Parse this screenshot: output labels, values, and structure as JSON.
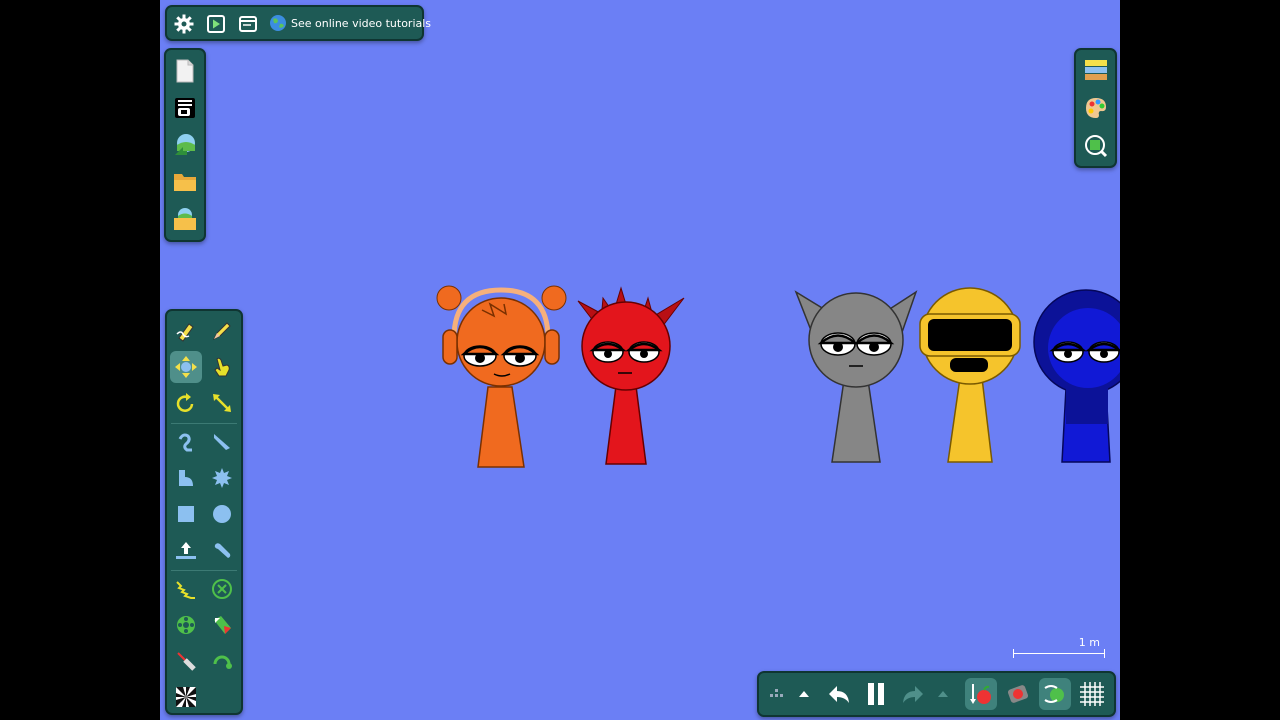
{
  "app": {
    "background_color": "#6b7ff5",
    "panel_color": "#1e5a55"
  },
  "top_bar": {
    "settings_icon": "gear-icon",
    "play_icon": "play-window-icon",
    "window_icon": "window-icon",
    "tutorial_icon": "globe-icon",
    "tutorial_label": "See online video tutorials"
  },
  "file_panel": {
    "items": [
      {
        "name": "new-file",
        "icon": "blank-page-icon"
      },
      {
        "name": "save",
        "icon": "save-icon"
      },
      {
        "name": "load-scene",
        "icon": "scene-open-icon"
      },
      {
        "name": "open-folder",
        "icon": "folder-icon"
      },
      {
        "name": "browse-scenes",
        "icon": "scene-folder-icon"
      }
    ]
  },
  "tool_panel": {
    "selected": "move",
    "tools": [
      "draw",
      "pencil",
      "move",
      "drag",
      "rotate",
      "scale",
      "rope",
      "knife",
      "polygon",
      "gear",
      "box",
      "circle",
      "plane",
      "brush",
      "spring",
      "fixate",
      "hinge",
      "thruster",
      "laser",
      "tracer",
      "chain",
      "spiral"
    ]
  },
  "right_panel": {
    "items": [
      {
        "name": "layers",
        "icon": "layers-icon"
      },
      {
        "name": "palette",
        "icon": "palette-icon"
      },
      {
        "name": "zoom",
        "icon": "zoom-icon"
      }
    ]
  },
  "bottom_bar": {
    "items": [
      "grid-dots",
      "more",
      "undo",
      "pause",
      "redo",
      "more-redo",
      "gravity",
      "attraction",
      "sync",
      "grid"
    ],
    "pause_state": "paused-icon"
  },
  "scale": {
    "label": "1 m"
  },
  "characters": [
    {
      "name": "oren",
      "color": "#f06a1f"
    },
    {
      "name": "raddy",
      "color": "#e3151c"
    },
    {
      "name": "gray",
      "color": "#868686"
    },
    {
      "name": "yellow",
      "color": "#f5c42c"
    },
    {
      "name": "blue",
      "color": "#1119d6"
    }
  ]
}
